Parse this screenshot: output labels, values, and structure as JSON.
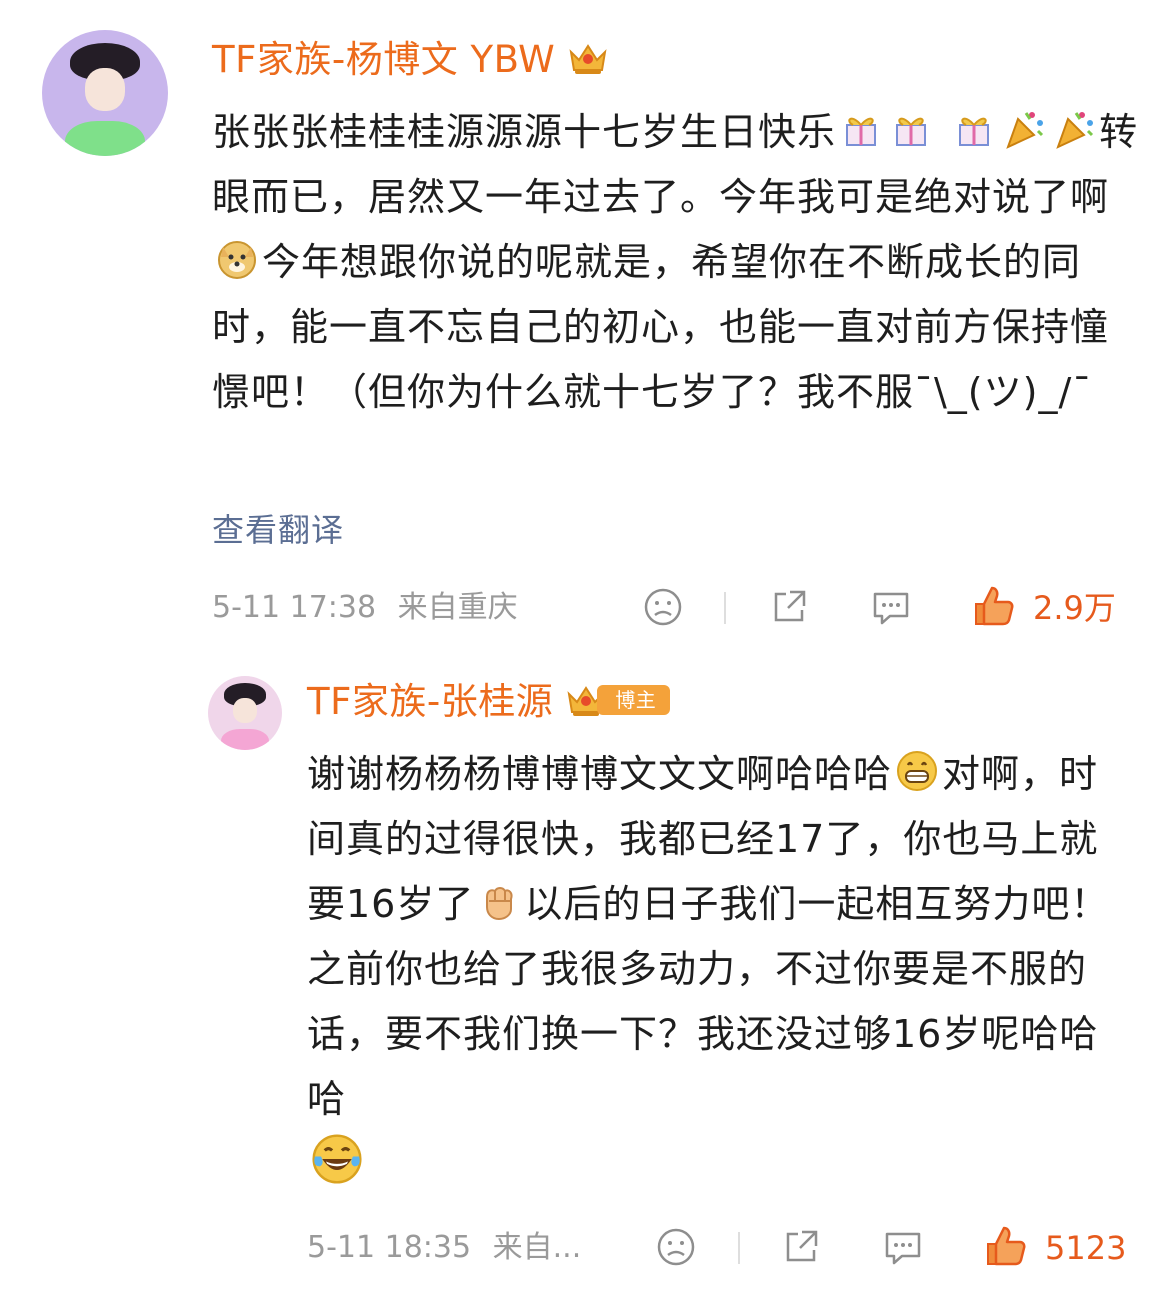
{
  "comments": [
    {
      "username": "TF家族-杨博文 YBW",
      "badge_icon": "crown-icon",
      "text_parts": [
        "张张张桂桂桂源源源十七岁生日快乐",
        "转眼而已，居然又一年过去了。今年我可是绝对说了啊",
        "今年想跟你说的呢就是，希望你在不断成长的同时，能一直不忘自己的初心，也能一直对前方保持憧憬吧！（但你为什么就十七岁了？我不服¯\\_(ツ)_/¯"
      ],
      "emojis": [
        "gift-icon",
        "gift-icon",
        "gift-icon",
        "party-popper-icon",
        "party-popper-icon",
        "doge-icon"
      ],
      "translate_label": "查看翻译",
      "timestamp": "5-11 17:38",
      "location": "来自重庆",
      "like_count": "2.9万"
    },
    {
      "username": "TF家族-张桂源",
      "badge_icon": "crown-icon",
      "badge_label": "博主",
      "text_parts": [
        "谢谢杨杨杨博博博文文文啊哈哈哈",
        "对啊，时间真的过得很快，我都已经17了，你也马上就要16岁了",
        "以后的日子我们一起相互努力吧！之前你也给了我很多动力，不过你要是不服的话，要不我们换一下？我还没过够16岁呢哈哈哈"
      ],
      "emojis": [
        "grin-icon",
        "fist-icon",
        "laugh-tears-icon"
      ],
      "timestamp": "5-11 18:35",
      "location": "来自...",
      "like_count": "5123"
    }
  ],
  "actions": [
    "dislike-icon",
    "share-icon",
    "reply-icon",
    "like-icon"
  ],
  "colors": {
    "username": "#ec6b1c",
    "translate": "#5b6e93",
    "meta": "#9a9a9a",
    "like": "#e65a1c",
    "badge": "#f4a23a"
  }
}
